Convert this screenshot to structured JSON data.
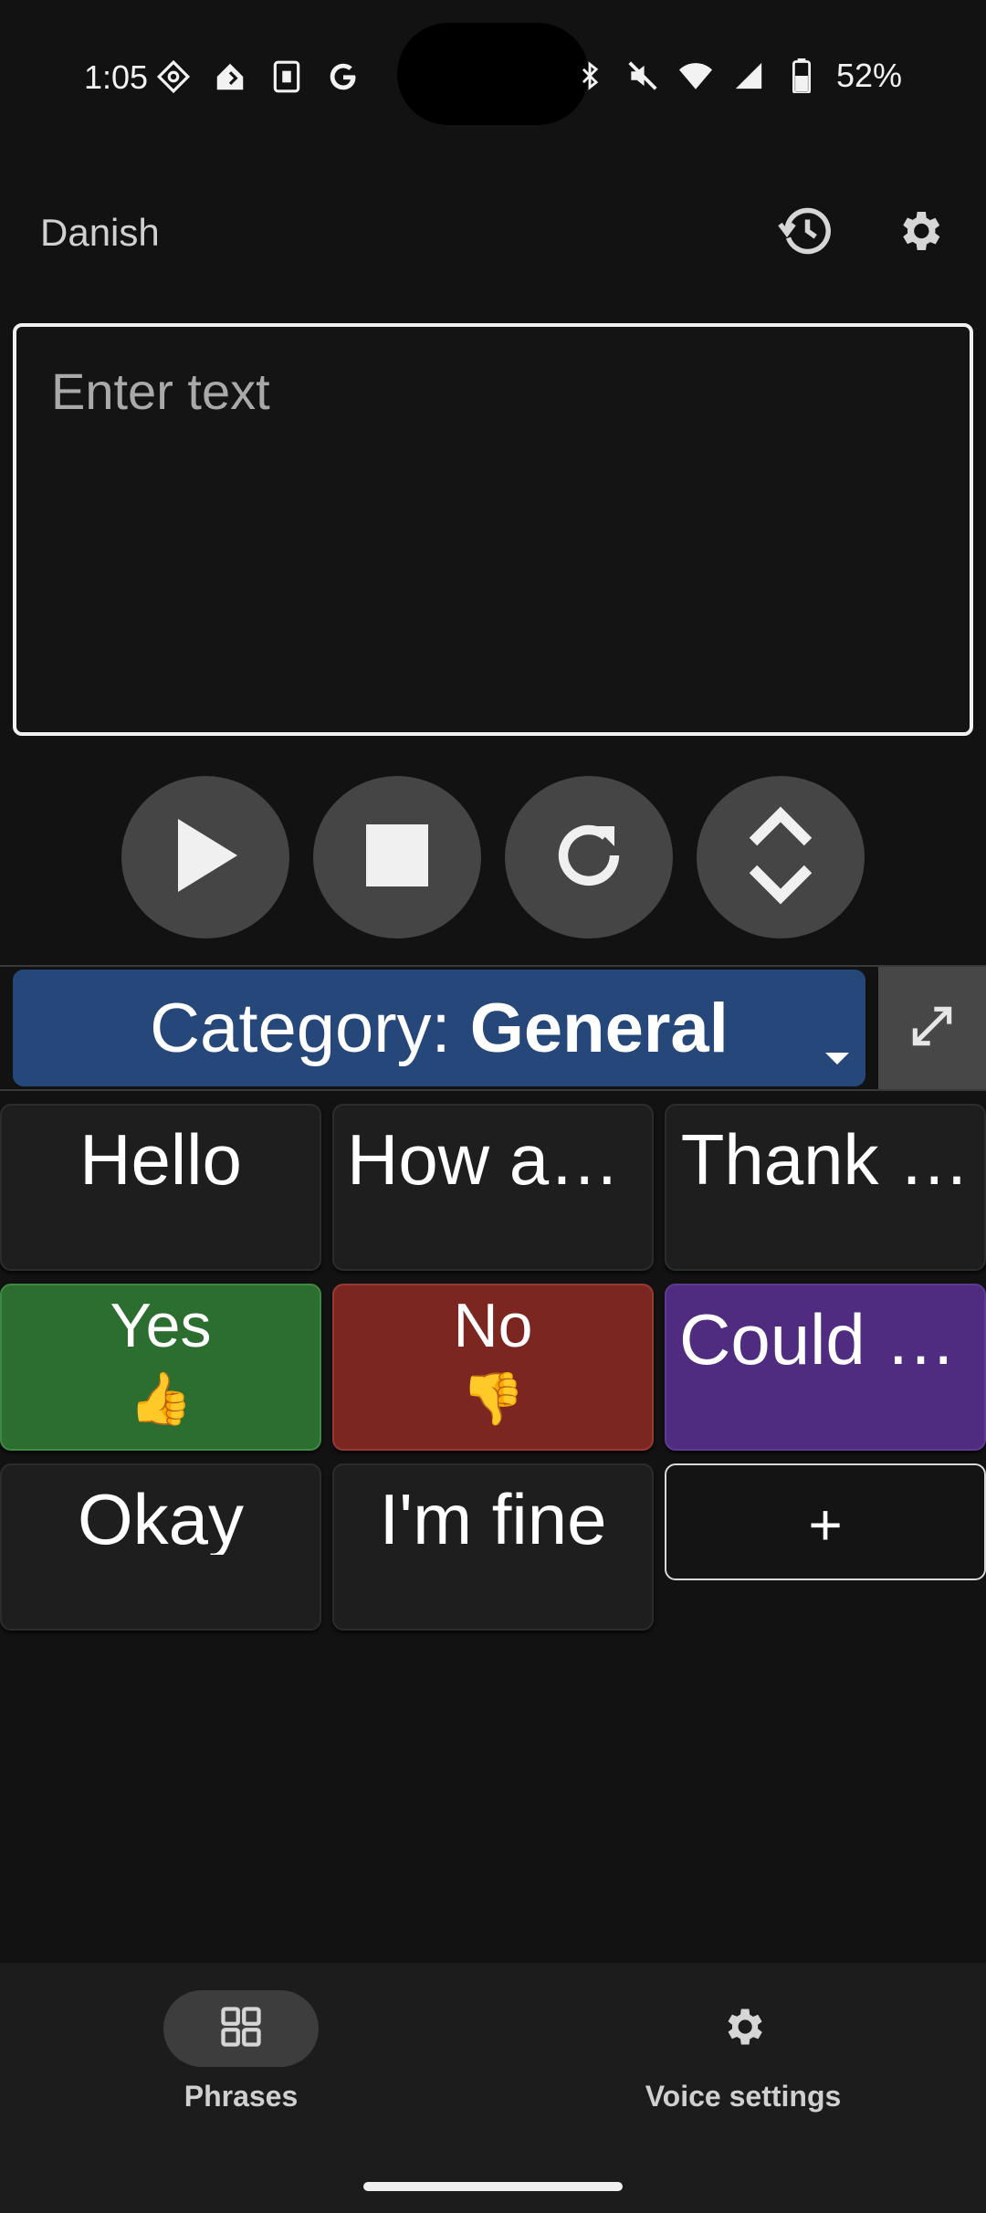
{
  "status_bar": {
    "time": "1:05",
    "battery_percent": "52%",
    "left_icons": [
      "target-icon",
      "home-icon",
      "sim-icon",
      "google-icon"
    ],
    "right_icons": [
      "bluetooth-icon",
      "mute-icon",
      "wifi-icon",
      "signal-icon",
      "battery-icon"
    ]
  },
  "header": {
    "language": "Danish",
    "history_icon": "history-icon",
    "settings_icon": "gear-icon"
  },
  "text_input": {
    "value": "",
    "placeholder": "Enter text"
  },
  "controls": [
    {
      "name": "play",
      "icon": "play-icon"
    },
    {
      "name": "stop",
      "icon": "stop-icon"
    },
    {
      "name": "refresh",
      "icon": "refresh-icon"
    },
    {
      "name": "expand-collapse",
      "icon": "chevron-up-down-icon"
    }
  ],
  "category": {
    "prefix": "Category: ",
    "value": "General"
  },
  "phrases": [
    {
      "label": "Hello",
      "emoji": "",
      "color": "#1e1e1e"
    },
    {
      "label": "How ar…",
      "emoji": "",
      "color": "#1e1e1e"
    },
    {
      "label": "Thank …",
      "emoji": "",
      "color": "#1e1e1e"
    },
    {
      "label": "Yes",
      "emoji": "👍",
      "color": "#2c6e2f"
    },
    {
      "label": "No",
      "emoji": "👎",
      "color": "#7c2621"
    },
    {
      "label": "Could y…",
      "emoji": "",
      "color": "#4f2c80"
    },
    {
      "label": "Okay",
      "emoji": "",
      "color": "#1e1e1e"
    },
    {
      "label": "I'm fine",
      "emoji": "",
      "color": "#1e1e1e"
    },
    {
      "label": "+",
      "emoji": "",
      "color": "#141414"
    }
  ],
  "bottom_nav": {
    "items": [
      {
        "label": "Phrases",
        "icon": "grid-icon",
        "active": true
      },
      {
        "label": "Voice settings",
        "icon": "gear-icon",
        "active": false
      }
    ]
  },
  "colors": {
    "background": "#121212",
    "category_bg": "#26477a",
    "control_bg": "#454545"
  }
}
